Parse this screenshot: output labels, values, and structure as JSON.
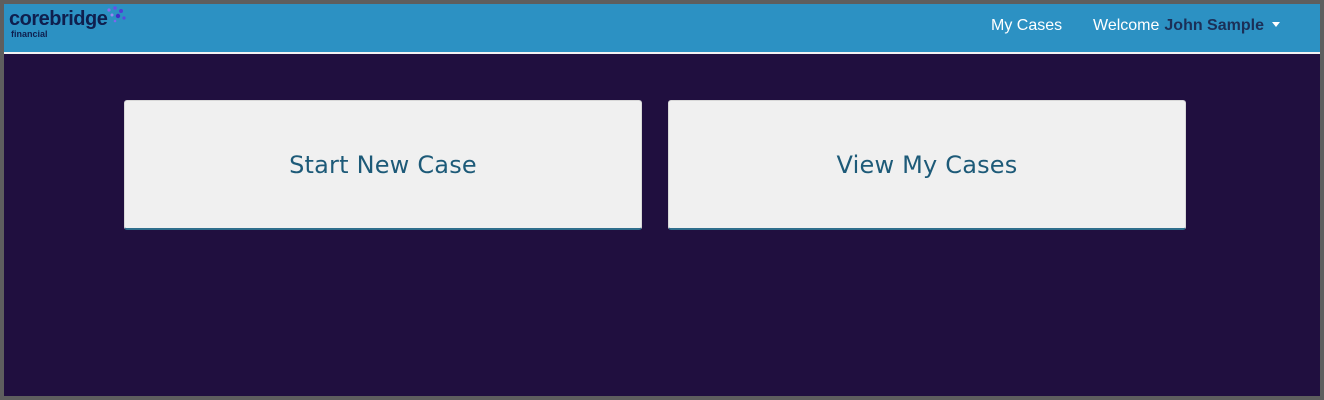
{
  "brand": {
    "name": "corebridge",
    "subtitle": "financial"
  },
  "nav": {
    "my_cases": "My Cases",
    "welcome_prefix": "Welcome",
    "user_name": "John Sample"
  },
  "tiles": [
    {
      "label": "Start New Case"
    },
    {
      "label": "View My Cases"
    }
  ],
  "colors": {
    "navbar": "#2c91c3",
    "background": "#200f3f",
    "tile": "#f0f0f0",
    "tile_text": "#1d5a78"
  }
}
